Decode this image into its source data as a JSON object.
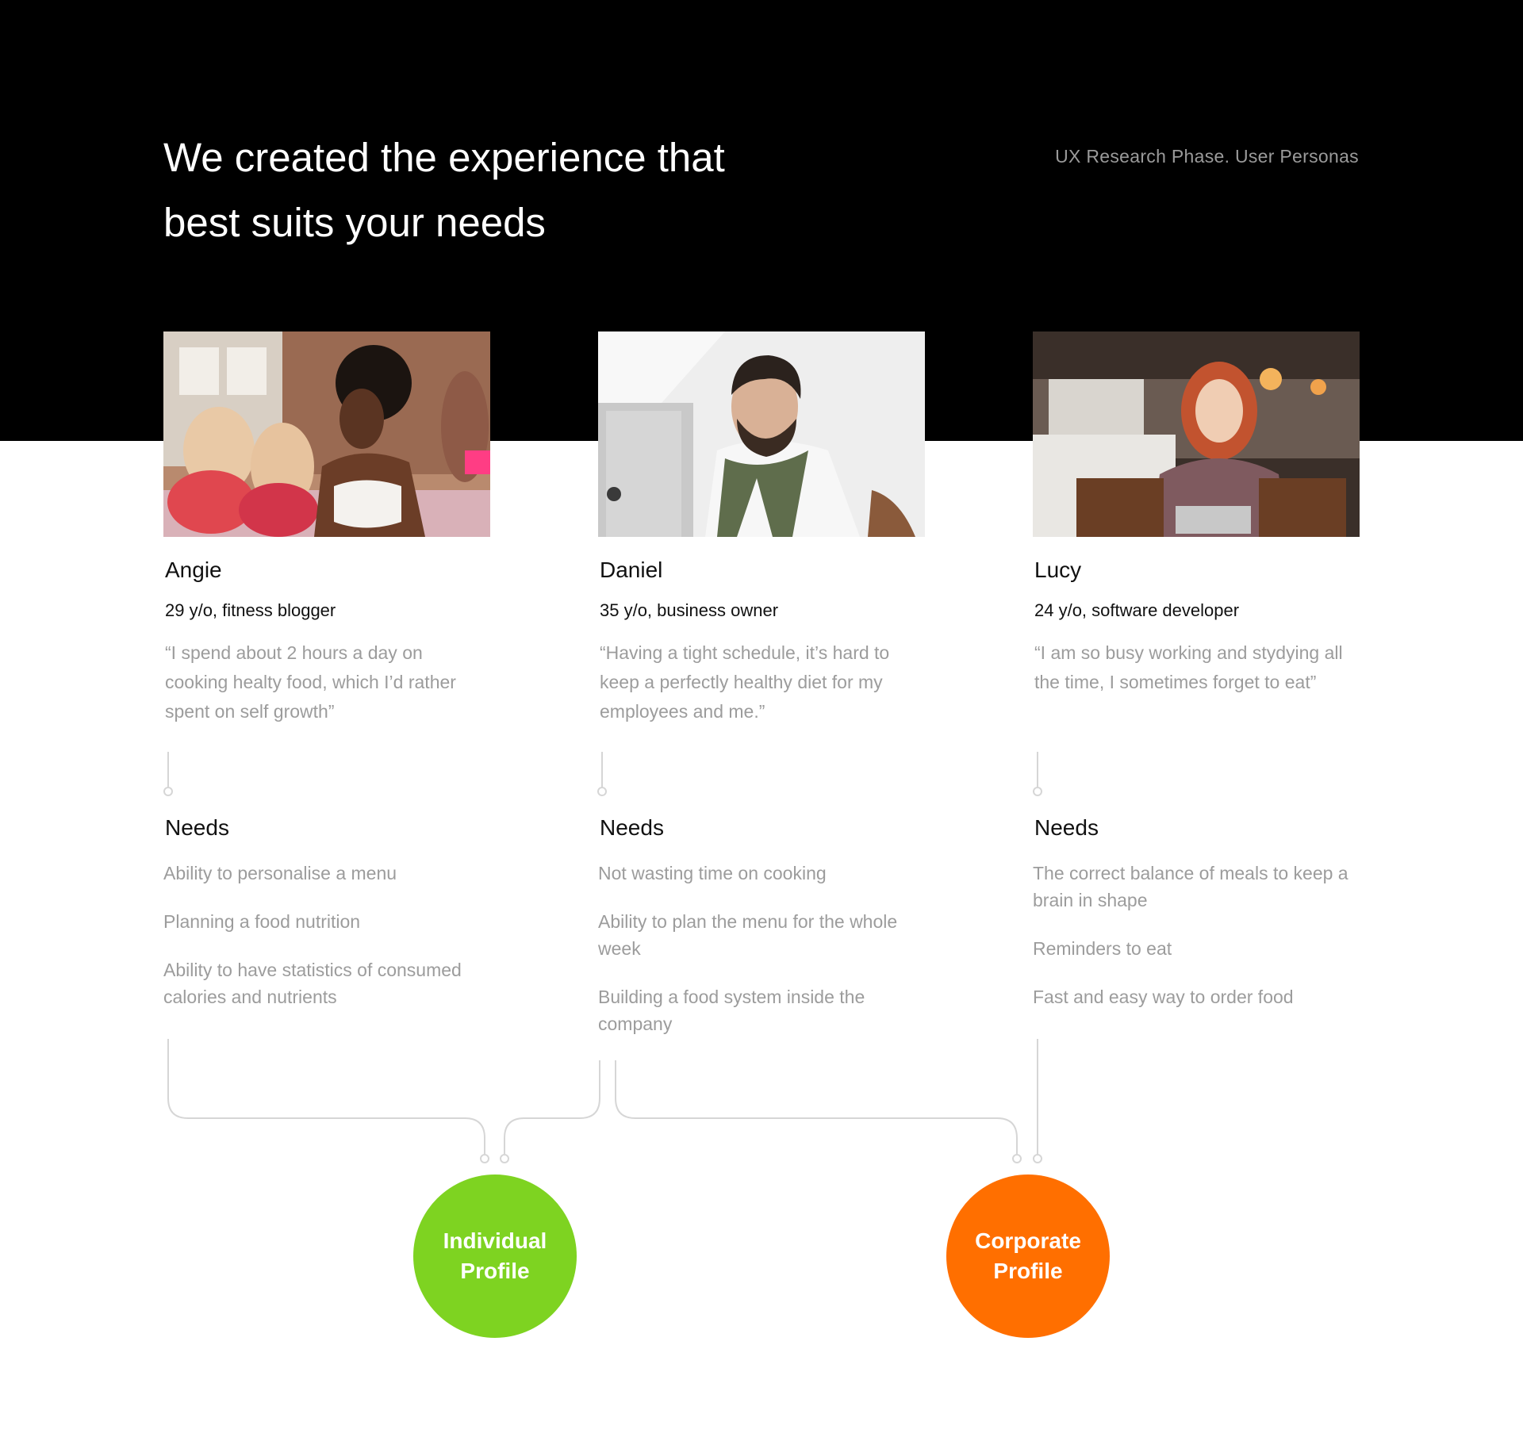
{
  "header": {
    "title_line1": "We created the experience that",
    "title_line2": "best suits your needs",
    "subtitle": "UX Research Phase. User Personas"
  },
  "personas": [
    {
      "name": "Angie",
      "meta": "29 y/o, fitness blogger",
      "quote": "“I spend about 2 hours a day on cooking healty food, which I’d rather spent on self growth”",
      "needs_label": "Needs",
      "needs": [
        "Ability to personalise a menu",
        "Planning a food nutrition",
        "Ability to have statistics of consumed calories and nutrients"
      ]
    },
    {
      "name": "Daniel",
      "meta": "35 y/o, business owner",
      "quote": "“Having a tight schedule, it’s hard to keep a perfectly healthy diet for my employees and me.”",
      "needs_label": "Needs",
      "needs": [
        "Not wasting time on cooking",
        "Ability to plan the menu for the whole week",
        "Building a food system inside the company"
      ]
    },
    {
      "name": "Lucy",
      "meta": "24 y/o, software developer",
      "quote": "“I am so busy working and stydying all the time, I sometimes forget to eat”",
      "needs_label": "Needs",
      "needs": [
        "The correct balance of meals to keep a brain in shape",
        "Reminders to eat",
        "Fast and easy way to order food"
      ]
    }
  ],
  "profiles": [
    {
      "line1": "Individual",
      "line2": "Profile",
      "color": "#7ed321"
    },
    {
      "line1": "Corporate",
      "line2": "Profile",
      "color": "#ff6f00"
    }
  ]
}
